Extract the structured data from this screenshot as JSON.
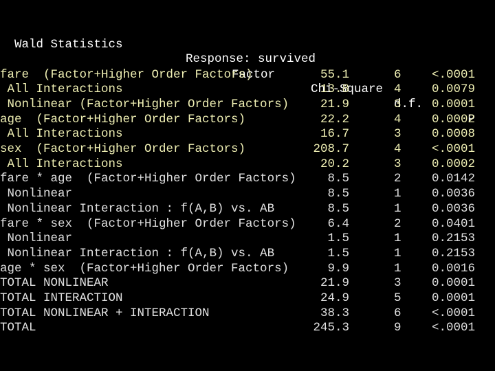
{
  "title": {
    "left": "Wald Statistics",
    "response": "Response: survived"
  },
  "columns": {
    "factor": "Factor",
    "chisq": "Chi-Square",
    "df": "d.f.",
    "p": "P"
  },
  "colors": {
    "background": "#000000",
    "highlight_rows": "#f0f0b4",
    "normal_rows": "#e0e0e0",
    "header": "#ffffff"
  },
  "rows": [
    {
      "factor": "fare  (Factor+Higher Order Factors)",
      "chisq": "55.1",
      "df": "6",
      "p": "<.0001",
      "highlight": true
    },
    {
      "factor": " All Interactions",
      "chisq": "13.8",
      "df": "4",
      "p": "0.0079",
      "highlight": true
    },
    {
      "factor": " Nonlinear (Factor+Higher Order Factors)",
      "chisq": "21.9",
      "df": "3",
      "p": "0.0001",
      "highlight": true
    },
    {
      "factor": "age  (Factor+Higher Order Factors)",
      "chisq": "22.2",
      "df": "4",
      "p": "0.0002",
      "highlight": true
    },
    {
      "factor": " All Interactions",
      "chisq": "16.7",
      "df": "3",
      "p": "0.0008",
      "highlight": true
    },
    {
      "factor": "sex  (Factor+Higher Order Factors)",
      "chisq": "208.7",
      "df": "4",
      "p": "<.0001",
      "highlight": true
    },
    {
      "factor": " All Interactions",
      "chisq": "20.2",
      "df": "3",
      "p": "0.0002",
      "highlight": true
    },
    {
      "factor": "fare * age  (Factor+Higher Order Factors)",
      "chisq": "8.5",
      "df": "2",
      "p": "0.0142",
      "highlight": false
    },
    {
      "factor": " Nonlinear",
      "chisq": "8.5",
      "df": "1",
      "p": "0.0036",
      "highlight": false
    },
    {
      "factor": " Nonlinear Interaction : f(A,B) vs. AB",
      "chisq": "8.5",
      "df": "1",
      "p": "0.0036",
      "highlight": false
    },
    {
      "factor": "fare * sex  (Factor+Higher Order Factors)",
      "chisq": "6.4",
      "df": "2",
      "p": "0.0401",
      "highlight": false
    },
    {
      "factor": " Nonlinear",
      "chisq": "1.5",
      "df": "1",
      "p": "0.2153",
      "highlight": false
    },
    {
      "factor": " Nonlinear Interaction : f(A,B) vs. AB",
      "chisq": "1.5",
      "df": "1",
      "p": "0.2153",
      "highlight": false
    },
    {
      "factor": "age * sex  (Factor+Higher Order Factors)",
      "chisq": "9.9",
      "df": "1",
      "p": "0.0016",
      "highlight": false
    },
    {
      "factor": "TOTAL NONLINEAR",
      "chisq": "21.9",
      "df": "3",
      "p": "0.0001",
      "highlight": false
    },
    {
      "factor": "TOTAL INTERACTION",
      "chisq": "24.9",
      "df": "5",
      "p": "0.0001",
      "highlight": false
    },
    {
      "factor": "TOTAL NONLINEAR + INTERACTION",
      "chisq": "38.3",
      "df": "6",
      "p": "<.0001",
      "highlight": false
    },
    {
      "factor": "TOTAL",
      "chisq": "245.3",
      "df": "9",
      "p": "<.0001",
      "highlight": false
    }
  ]
}
